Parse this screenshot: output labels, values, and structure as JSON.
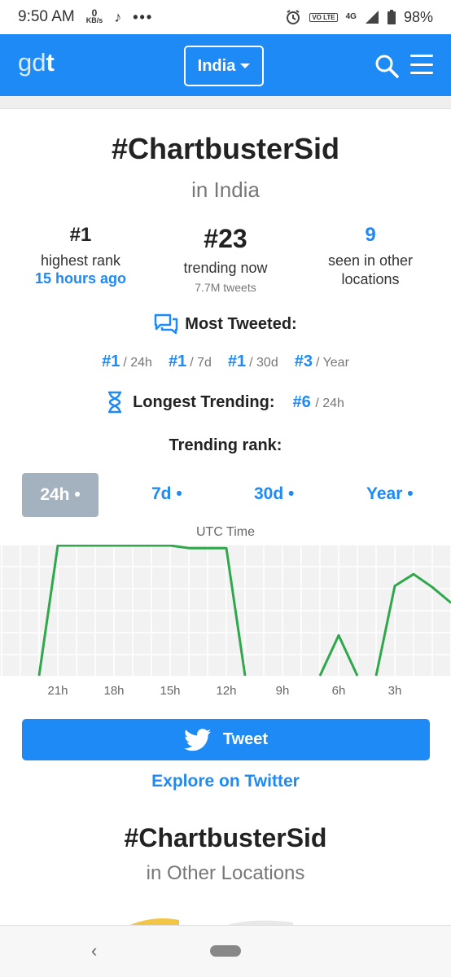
{
  "status": {
    "time": "9:50 AM",
    "kbs_value": "0",
    "kbs_unit": "KB/s",
    "dots": "•••",
    "volte": "VO LTE",
    "net": "4G",
    "battery": "98%"
  },
  "header": {
    "logo_light": "gd",
    "logo_bold": "t",
    "country": "India"
  },
  "trend": {
    "hashtag": "#ChartbusterSid",
    "location": "in India"
  },
  "stats": {
    "highest_rank": "#1",
    "highest_rank_label": "highest rank",
    "highest_rank_when": "15 hours ago",
    "trending_now": "#23",
    "trending_now_label": "trending now",
    "tweets": "7.7M tweets",
    "other_locations": "9",
    "other_locations_label_1": "seen in other",
    "other_locations_label_2": "locations"
  },
  "most_tweeted": {
    "title": "Most Tweeted:",
    "ranks": [
      {
        "rank": "#1",
        "period": "/ 24h"
      },
      {
        "rank": "#1",
        "period": "/ 7d"
      },
      {
        "rank": "#1",
        "period": "/ 30d"
      },
      {
        "rank": "#3",
        "period": "/ Year"
      }
    ]
  },
  "longest_trending": {
    "title": "Longest Trending:",
    "rank": "#6",
    "period": "/ 24h"
  },
  "trending_rank": {
    "title": "Trending rank:",
    "tabs": [
      "24h •",
      "7d •",
      "30d •",
      "Year •"
    ],
    "active_tab": "24h •"
  },
  "chart_data": {
    "type": "line",
    "title": "UTC Time",
    "xlabel": "",
    "ylabel": "",
    "x_tick_labels": [
      "21h",
      "18h",
      "15h",
      "12h",
      "9h",
      "6h",
      "3h"
    ],
    "line_color": "#2ea84a",
    "grid": true,
    "series": [
      {
        "segments": [
          [
            [
              22,
              0
            ],
            [
              21,
              1
            ],
            [
              20,
              1
            ],
            [
              19,
              1
            ],
            [
              18,
              1
            ],
            [
              17,
              1
            ],
            [
              16,
              1
            ],
            [
              15,
              1
            ],
            [
              14,
              0.98
            ],
            [
              13,
              0.98
            ],
            [
              12,
              0.98
            ],
            [
              11,
              0
            ]
          ],
          [
            [
              7,
              0
            ],
            [
              6,
              0.31
            ],
            [
              5,
              0
            ]
          ],
          [
            [
              4,
              0
            ],
            [
              3,
              0.69
            ],
            [
              2,
              0.78
            ],
            [
              1,
              0.68
            ],
            [
              0,
              0.56
            ]
          ]
        ]
      }
    ]
  },
  "actions": {
    "tweet": "Tweet",
    "explore": "Explore on Twitter"
  },
  "other_locations": {
    "hashtag": "#ChartbusterSid",
    "subtitle": "in Other Locations"
  },
  "nav": {
    "back": "‹"
  }
}
